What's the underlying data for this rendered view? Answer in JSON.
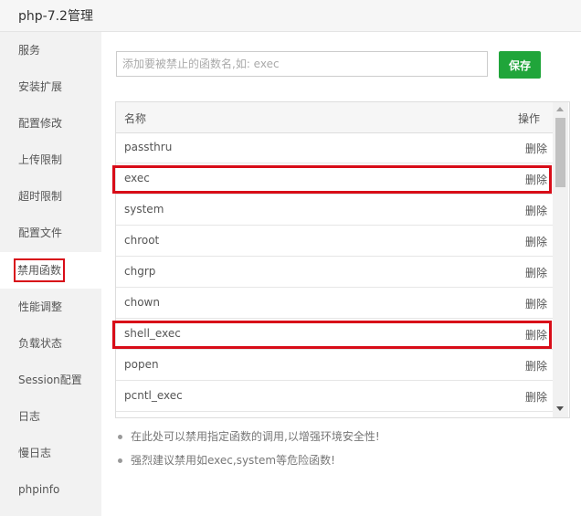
{
  "window": {
    "title": "php-7.2管理"
  },
  "sidebar": {
    "items": [
      {
        "label": "服务"
      },
      {
        "label": "安装扩展"
      },
      {
        "label": "配置修改"
      },
      {
        "label": "上传限制"
      },
      {
        "label": "超时限制"
      },
      {
        "label": "配置文件"
      },
      {
        "label": "禁用函数"
      },
      {
        "label": "性能调整"
      },
      {
        "label": "负载状态"
      },
      {
        "label": "Session配置"
      },
      {
        "label": "日志"
      },
      {
        "label": "慢日志"
      },
      {
        "label": "phpinfo"
      }
    ],
    "active_index": 6
  },
  "form": {
    "placeholder": "添加要被禁止的函数名,如: exec",
    "save_label": "保存"
  },
  "table": {
    "headers": {
      "name": "名称",
      "action": "操作"
    },
    "rows": [
      {
        "name": "passthru",
        "action": "删除"
      },
      {
        "name": "exec",
        "action": "删除"
      },
      {
        "name": "system",
        "action": "删除"
      },
      {
        "name": "chroot",
        "action": "删除"
      },
      {
        "name": "chgrp",
        "action": "删除"
      },
      {
        "name": "chown",
        "action": "删除"
      },
      {
        "name": "shell_exec",
        "action": "删除"
      },
      {
        "name": "popen",
        "action": "删除"
      },
      {
        "name": "pcntl_exec",
        "action": "删除"
      }
    ],
    "highlighted_rows": [
      "exec",
      "shell_exec"
    ]
  },
  "tips": [
    "在此处可以禁用指定函数的调用,以增强环境安全性!",
    "强烈建议禁用如exec,system等危险函数!"
  ],
  "colors": {
    "accent": "#20a53a",
    "highlight": "#d80c18"
  }
}
